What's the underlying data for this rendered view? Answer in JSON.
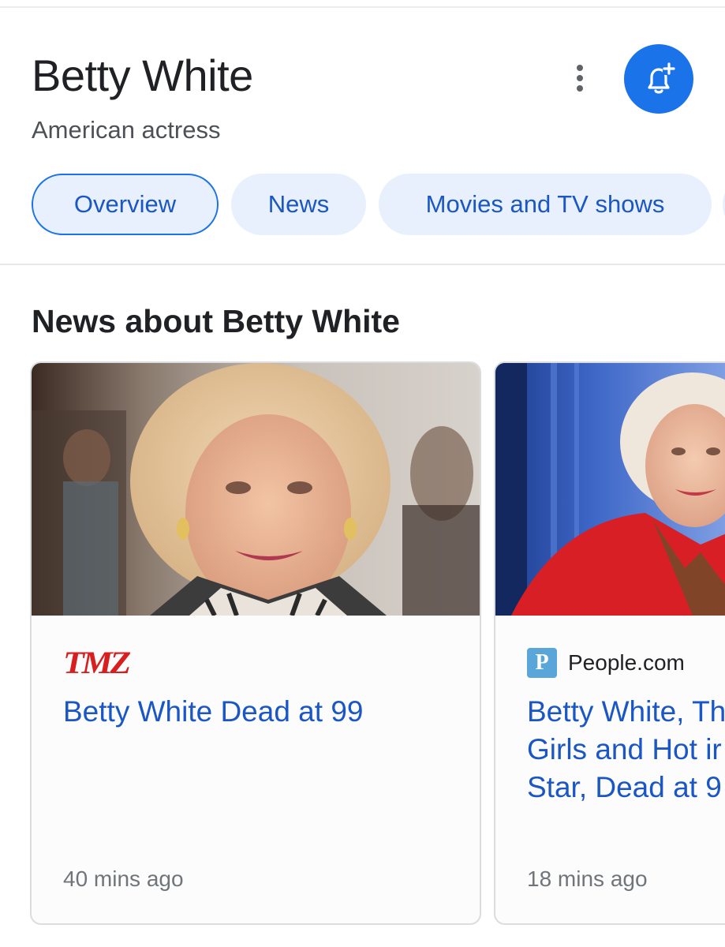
{
  "entity": {
    "title": "Betty White",
    "subtitle": "American actress"
  },
  "header_actions": {
    "more_icon": "more-vert-icon",
    "follow_icon": "bell-plus-icon"
  },
  "chips": [
    {
      "label": "Overview",
      "active": true
    },
    {
      "label": "News",
      "active": false
    },
    {
      "label": "Movies and TV shows",
      "active": false
    }
  ],
  "news_section": {
    "title": "News about Betty White",
    "cards": [
      {
        "source": "TMZ",
        "headline": "Betty White Dead at 99",
        "time": "40 mins ago"
      },
      {
        "source": "People.com",
        "source_icon_letter": "P",
        "headline_lines": [
          "Betty White, Th",
          "Girls and Hot ir",
          "Star, Dead at 9"
        ],
        "time": "18 mins ago"
      }
    ]
  },
  "colors": {
    "accent_blue": "#1a73e8",
    "link_blue": "#1a56c4",
    "chip_bg": "#e8f0fe",
    "tmz_red": "#d81f1f"
  }
}
